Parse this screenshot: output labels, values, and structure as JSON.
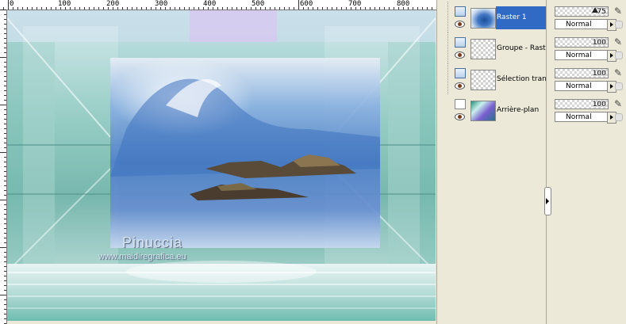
{
  "ruler": {
    "labels": [
      "0",
      "100",
      "200",
      "300",
      "400",
      "500",
      "600",
      "700",
      "800"
    ]
  },
  "watermark": {
    "name": "Pinuccia",
    "url": "www.maidiregrafica.eu"
  },
  "layers": [
    {
      "name": "Raster 1",
      "opacity": "75",
      "blend": "Normal",
      "selected": true,
      "kind": "raster"
    },
    {
      "name": "Groupe - Raster 1",
      "opacity": "100",
      "blend": "Normal",
      "selected": false,
      "kind": "group"
    },
    {
      "name": "Sélection transformée",
      "opacity": "100",
      "blend": "Normal",
      "selected": false,
      "kind": "selection"
    },
    {
      "name": "Arrière-plan",
      "opacity": "100",
      "blend": "Normal",
      "selected": false,
      "kind": "background"
    }
  ],
  "colors": {
    "selection": "#316ac5",
    "panel": "#ece9d8",
    "accent_teal": "#2f8f80",
    "accent_blue": "#3f6fb8"
  },
  "icons": {
    "visibility": "eye-icon",
    "layer_type": "raster-layer-icon",
    "edit": "pencil-icon",
    "lock": "lock-icon",
    "blend_arrow": "chevron-right-icon"
  }
}
